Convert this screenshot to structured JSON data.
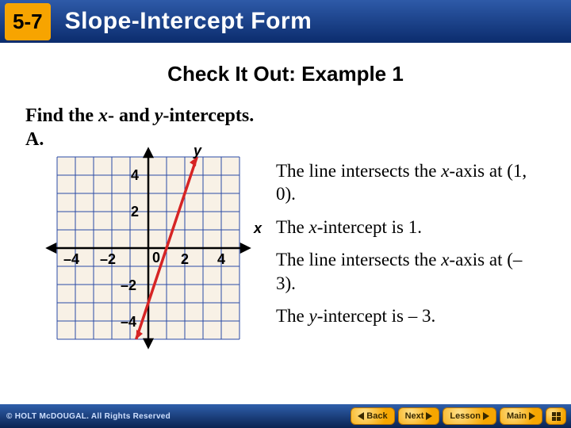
{
  "header": {
    "lesson_number": "5-7",
    "title": "Slope-Intercept Form"
  },
  "subheading": "Check It Out: Example 1",
  "problem": {
    "line1_a": "Find the ",
    "line1_b": "x",
    "line1_c": "- and ",
    "line1_d": "y",
    "line1_e": "-intercepts.",
    "line2": "A."
  },
  "notes": {
    "p1_a": "The line intersects the ",
    "p1_b": "x",
    "p1_c": "-axis at (1, 0).",
    "p2_a": "The ",
    "p2_b": "x",
    "p2_c": "-intercept is 1.",
    "p3_a": "The line intersects the ",
    "p3_b": "x",
    "p3_c": "-axis at (– 3).",
    "p4_a": "The ",
    "p4_b": "y",
    "p4_c": "-intercept is – 3."
  },
  "graph": {
    "x_axis_label": "x",
    "y_axis_label": "y",
    "ticks_x": [
      "–4",
      "–2",
      "0",
      "2",
      "4"
    ],
    "ticks_y_pos": [
      "2",
      "4"
    ],
    "ticks_y_neg": [
      "–2",
      "–4"
    ]
  },
  "chart_data": {
    "type": "line",
    "title": "",
    "xlabel": "x",
    "ylabel": "y",
    "xlim": [
      -5,
      5
    ],
    "ylim": [
      -5,
      5
    ],
    "x_ticks": [
      -4,
      -2,
      0,
      2,
      4
    ],
    "y_ticks": [
      -4,
      -2,
      0,
      2,
      4
    ],
    "series": [
      {
        "name": "line",
        "equation": "y = 3x - 3",
        "slope": 3,
        "y_intercept": -3,
        "x_intercept": 1,
        "points": [
          [
            -0.666,
            -5
          ],
          [
            2.666,
            5
          ]
        ]
      }
    ]
  },
  "footer": {
    "copyright": "© HOLT McDOUGAL. All Rights Reserved",
    "buttons": {
      "back": "Back",
      "next": "Next",
      "lesson": "Lesson",
      "main": "Main"
    }
  }
}
